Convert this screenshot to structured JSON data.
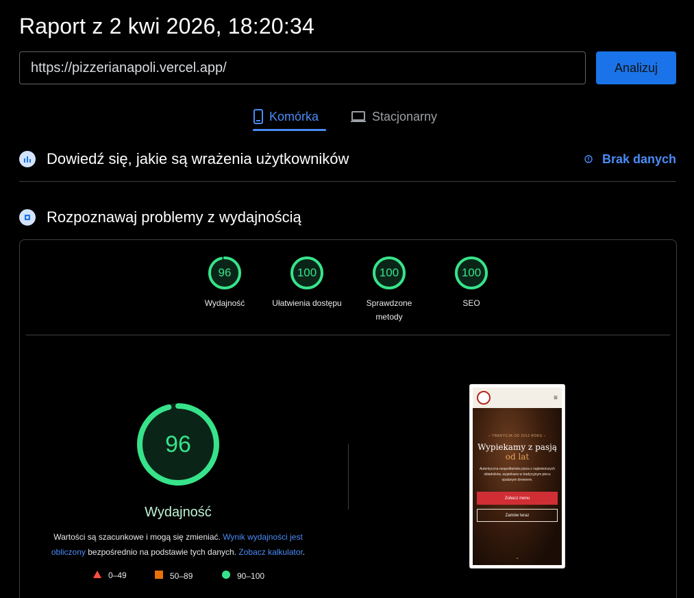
{
  "report": {
    "title": "Raport z 2 kwi 2026, 18:20:34"
  },
  "url_bar": {
    "value": "https://pizzerianapoli.vercel.app/",
    "analyze_label": "Analizuj"
  },
  "tabs": [
    {
      "label": "Komórka",
      "icon": "smartphone-icon",
      "active": true
    },
    {
      "label": "Stacjonarny",
      "icon": "laptop-icon",
      "active": false
    }
  ],
  "field_data": {
    "title": "Dowiedź się, jakie są wrażenia użytkowników",
    "status": "Brak danych",
    "icon": "users-chart-icon"
  },
  "lab_data": {
    "title": "Rozpoznawaj problemy z wydajnością",
    "icon": "lighthouse-icon"
  },
  "scores": [
    {
      "label": "Wydajność",
      "value": 96
    },
    {
      "label": "Ułatwienia dostępu",
      "value": 100
    },
    {
      "label": "Sprawdzone metody",
      "value": 100
    },
    {
      "label": "SEO",
      "value": 100
    }
  ],
  "performance": {
    "score": 96,
    "label": "Wydajność",
    "disclaimer_prefix": "Wartości są szacunkowe i mogą się zmieniać.",
    "disclaimer_link1": "Wynik wydajności jest obliczony",
    "disclaimer_middle": "bezpośrednio na podstawie tych danych.",
    "disclaimer_link2": "Zobacz kalkulator",
    "disclaimer_suffix": "."
  },
  "legend": [
    {
      "range": "0–49",
      "shape": "triangle",
      "color": "#ff4e42"
    },
    {
      "range": "50–89",
      "shape": "square",
      "color": "#e8710a"
    },
    {
      "range": "90–100",
      "shape": "circle",
      "color": "#37e38a"
    }
  ],
  "colors": {
    "accent": "#1a73e8",
    "pass": "#37e38a",
    "link": "#4a8cf7"
  },
  "phone_preview": {
    "tagline": "– TRADYCJA OD 2012 ROKU –",
    "heading_line1": "Wypiekamy z pasją",
    "heading_line2": "od lat",
    "paragraph": "Autentyczna neapolitańska pizza z najświeższych składników, wypiekana w tradycyjnym piecu opalanym drewnem.",
    "button_primary": "Zobacz menu",
    "button_secondary": "Zamów teraz",
    "scroll_hint": "⌄"
  }
}
